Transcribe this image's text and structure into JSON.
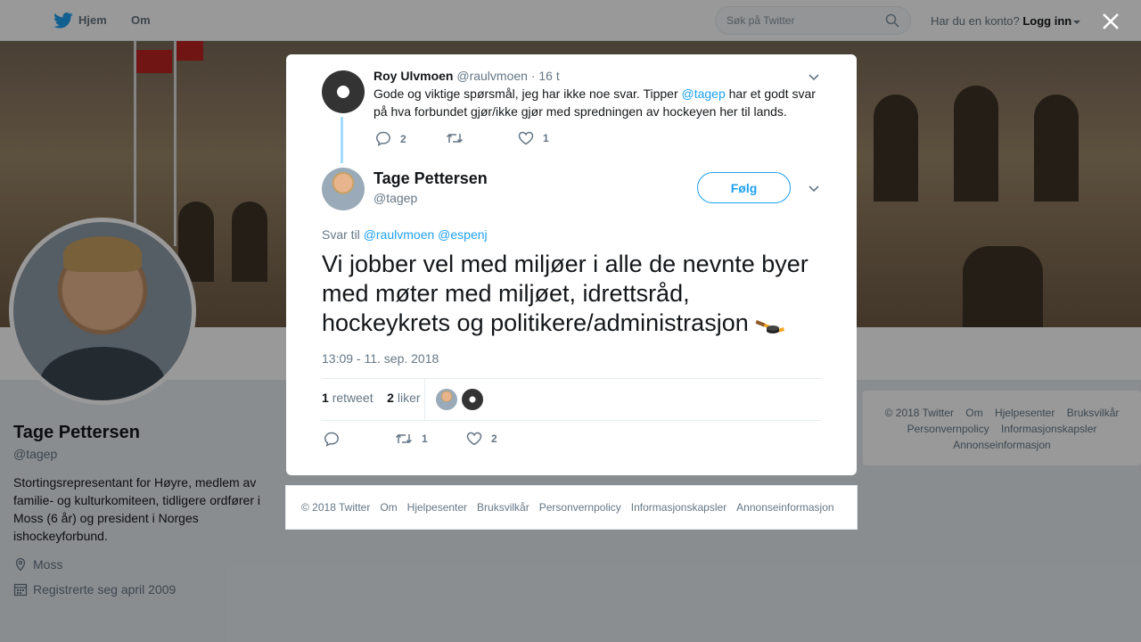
{
  "nav": {
    "home_label": "Hjem",
    "about_label": "Om",
    "search_placeholder": "Søk på Twitter",
    "account_prompt": "Har du en konto?",
    "login_label": "Logg inn"
  },
  "profile": {
    "name": "Tage Pettersen",
    "handle": "@tagep",
    "bio": "Stortingsrepresentant for Høyre, medlem av familie- og kulturkomiteen, tidligere ordfører i Moss (6 år) og president i Norges ishockeyforbund.",
    "location": "Moss",
    "joined": "Registrerte seg april 2009"
  },
  "side_footer": {
    "links": [
      "© 2018 Twitter",
      "Om",
      "Hjelpesenter",
      "Bruksvilkår",
      "Personvernpolicy",
      "Informasjonskapsler",
      "Annonseinformasjon"
    ]
  },
  "parent_tweet": {
    "name": "Roy Ulvmoen",
    "handle": "@raulvmoen",
    "time": "· 16 t",
    "text_before": "Gode og viktige spørsmål, jeg har ikke noe svar. Tipper ",
    "mention": "@tagep",
    "text_after": " har et godt svar på hva forbundet gjør/ikke gjør med spredningen av hockeyen her til lands.",
    "replies": "2",
    "likes": "1"
  },
  "main_tweet": {
    "name": "Tage Pettersen",
    "handle": "@tagep",
    "follow_label": "Følg",
    "reply_to_label": "Svar til",
    "reply_to_1": "@raulvmoen",
    "reply_to_2": "@espenj",
    "text": "Vi jobber vel med miljøer i alle de nevnte byer med møter med miljøet, idrettsråd, hockeykrets og politikere/administrasjon",
    "timestamp": "13:09 - 11. sep. 2018",
    "retweet_count": "1",
    "retweet_label": "retweet",
    "like_count": "2",
    "like_label": "liker",
    "action_retweets": "1",
    "action_likes": "2"
  },
  "modal_footer": {
    "links": [
      "© 2018 Twitter",
      "Om",
      "Hjelpesenter",
      "Bruksvilkår",
      "Personvernpolicy",
      "Informasjonskapsler",
      "Annonseinformasjon"
    ]
  },
  "colors": {
    "accent": "#1da1f2",
    "thread_line": "#a3dbff",
    "muted": "#657786"
  },
  "icons": [
    "twitter-bird-icon",
    "search-icon",
    "close-icon",
    "chevron-down-icon",
    "reply-icon",
    "retweet-icon",
    "heart-icon",
    "location-icon",
    "calendar-icon",
    "hockey-stick-emoji"
  ]
}
